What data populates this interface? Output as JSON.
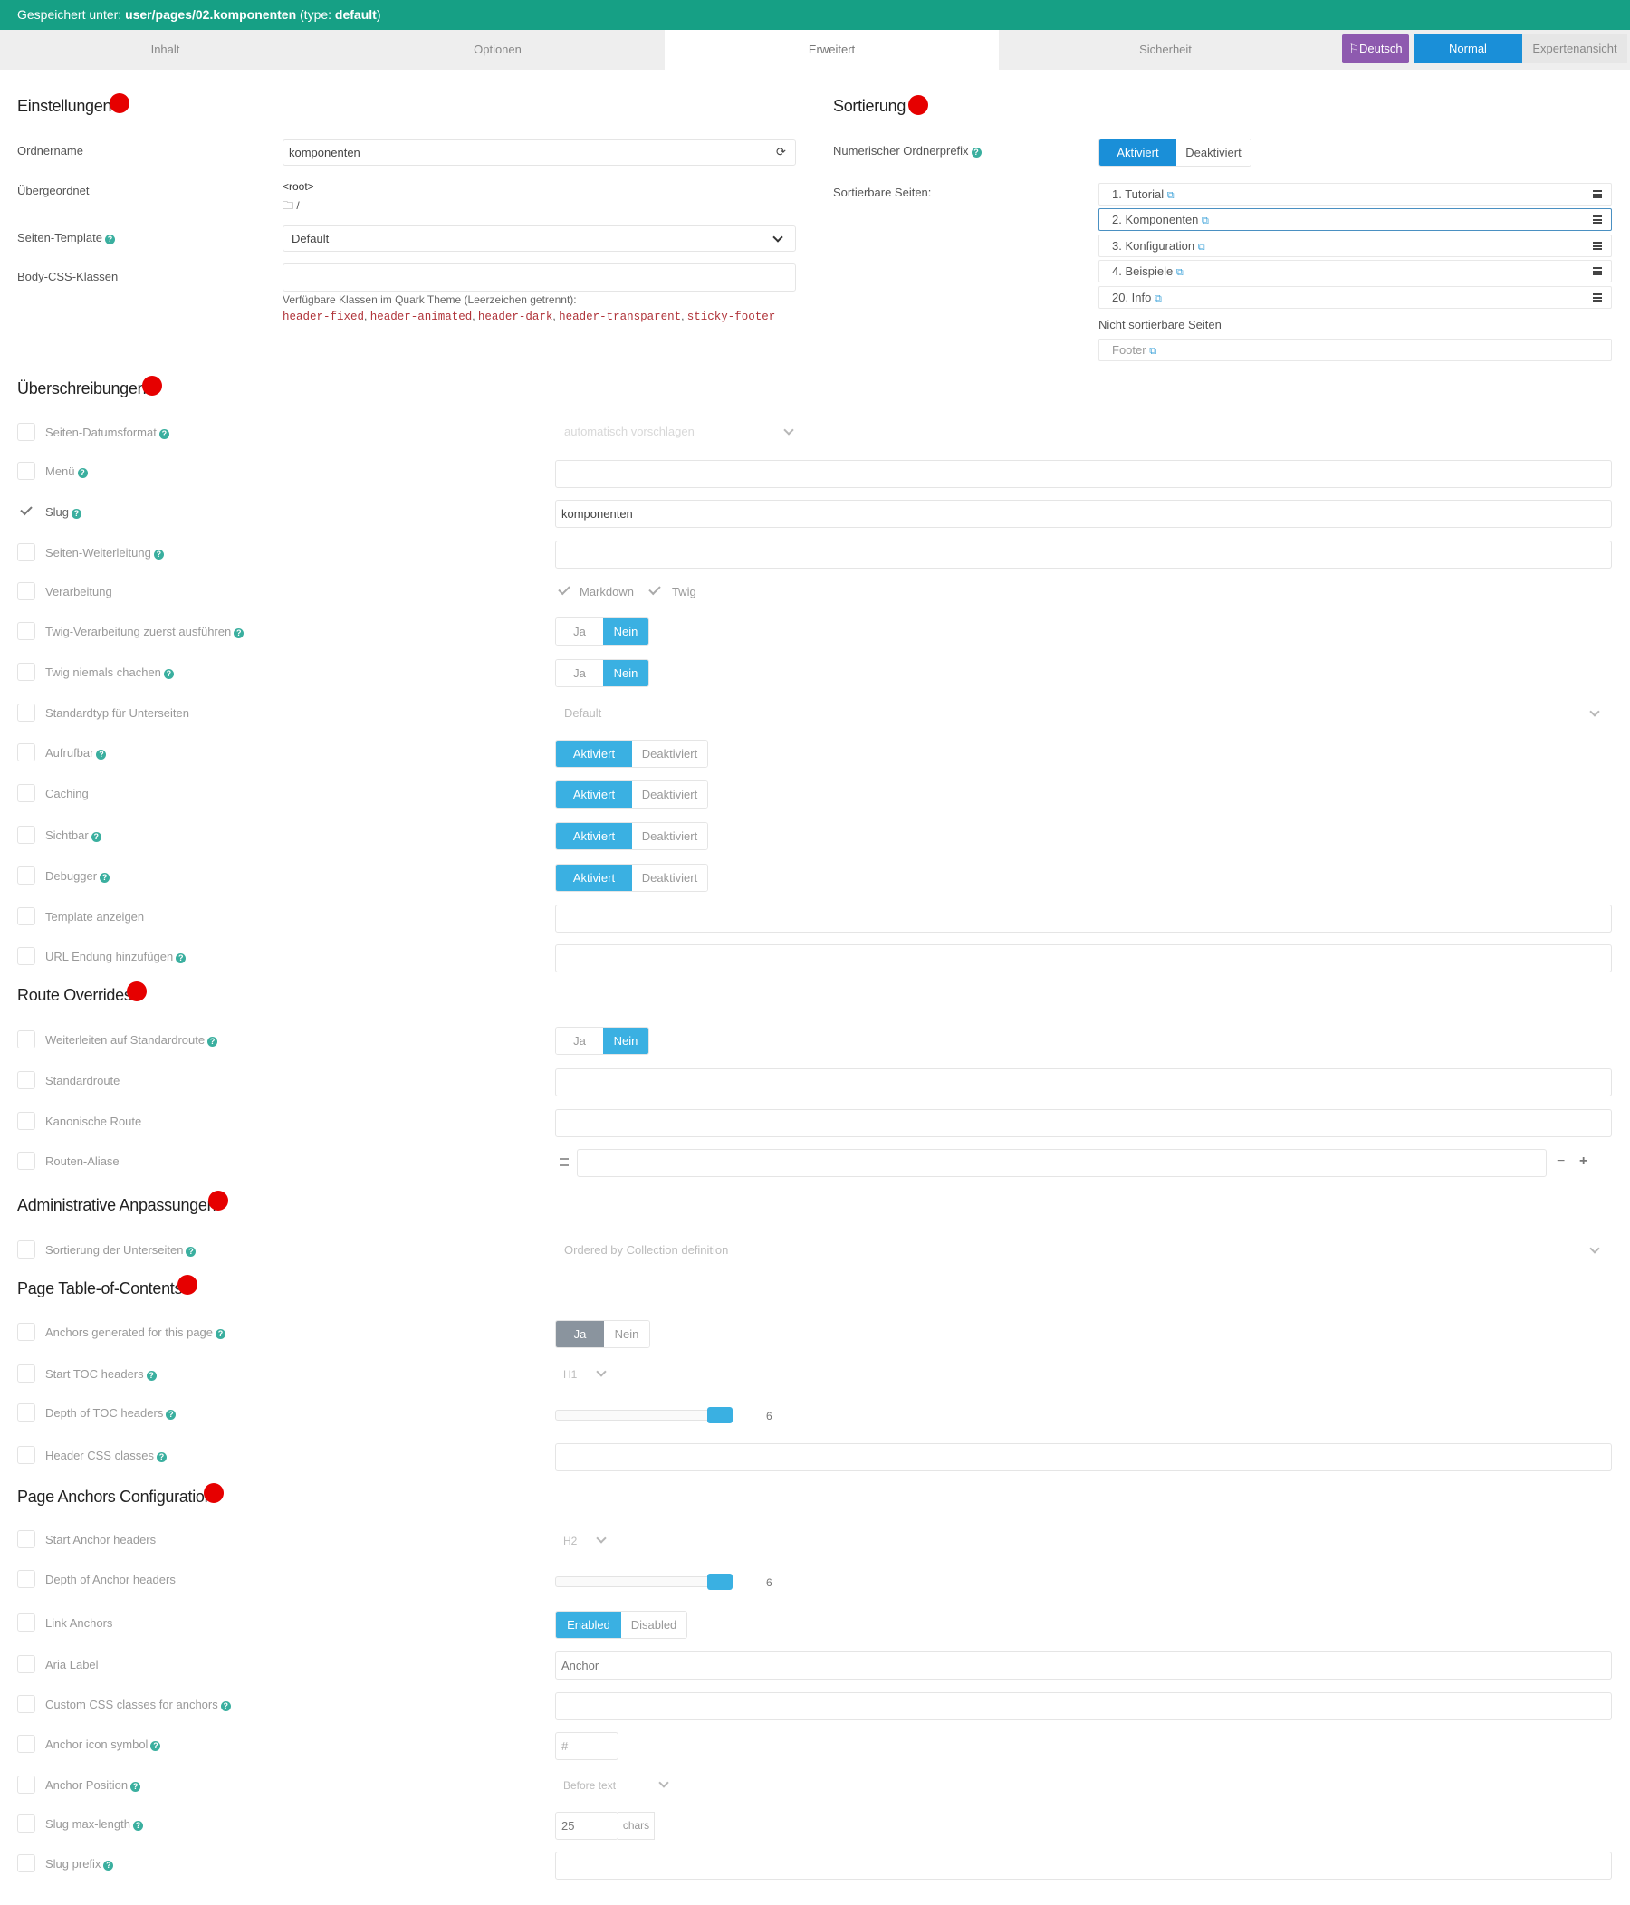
{
  "topbar": {
    "prefix": "Gespeichert unter: ",
    "path": "user/pages/02.komponenten",
    "type_prefix": " (type: ",
    "type": "default",
    "type_suffix": ")"
  },
  "tabs": [
    "Inhalt",
    "Optionen",
    "Erweitert",
    "Sicherheit"
  ],
  "active_tab": "Erweitert",
  "header_buttons": {
    "language": "Deutsch",
    "normal": "Normal",
    "expert": "Expertenansicht"
  },
  "colors": {
    "accent": "#16a085",
    "primary": "#3ab0e2",
    "badge": "#e60000",
    "language": "#8e5aaf"
  },
  "settings": {
    "title": "Einstellungen",
    "folder_label": "Ordnername",
    "folder_value": "komponenten",
    "parent_label": "Übergeordnet",
    "parent_value": "<root>",
    "parent_path": "/",
    "template_label": "Seiten-Template",
    "template_value": "Default",
    "body_css_label": "Body-CSS-Klassen",
    "body_css_value": "",
    "classes_hint": "Verfügbare Klassen im Quark Theme (Leerzeichen getrennt):",
    "classes": [
      "header-fixed",
      "header-animated",
      "header-dark",
      "header-transparent",
      "sticky-footer"
    ]
  },
  "sorting": {
    "title": "Sortierung",
    "numeric_prefix_label": "Numerischer Ordnerprefix",
    "numeric_on": "Aktiviert",
    "numeric_off": "Deaktiviert",
    "sortable_label": "Sortierbare Seiten:",
    "items": [
      "1. Tutorial",
      "2. Komponenten",
      "3. Konfiguration",
      "4. Beispiele",
      "20. Info"
    ],
    "unsortable_label": "Nicht sortierbare Seiten",
    "unsortable_items": [
      "Footer"
    ]
  },
  "overrides": {
    "title": "Überschreibungen",
    "date_format_label": "Seiten-Datumsformat",
    "date_format_value": "automatisch vorschlagen",
    "menu_label": "Menü",
    "slug_label": "Slug",
    "slug_value": "komponenten",
    "redirect_label": "Seiten-Weiterleitung",
    "process_label": "Verarbeitung",
    "process_markdown": "Markdown",
    "process_twig": "Twig",
    "twig_first_label": "Twig-Verarbeitung zuerst ausführen",
    "never_cache_twig_label": "Twig niemals chachen",
    "child_type_label": "Standardtyp für Unterseiten",
    "child_type_value": "Default",
    "routable_label": "Aufrufbar",
    "caching_label": "Caching",
    "visible_label": "Sichtbar",
    "debugger_label": "Debugger",
    "template_show_label": "Template anzeigen",
    "url_ext_label": "URL Endung hinzufügen",
    "yes": "Ja",
    "no": "Nein",
    "enabled": "Aktiviert",
    "disabled": "Deaktiviert"
  },
  "routes": {
    "title": "Route Overrides",
    "redirect_default_label": "Weiterleiten auf Standardroute",
    "default_route_label": "Standardroute",
    "canonical_label": "Kanonische Route",
    "aliases_label": "Routen-Aliase",
    "minus": "−",
    "plus": "+"
  },
  "admin": {
    "title": "Administrative Anpassungen",
    "child_order_label": "Sortierung der Unterseiten",
    "child_order_value": "Ordered by Collection definition"
  },
  "toc": {
    "title": "Page Table-of-Contents",
    "anchors_label": "Anchors generated for this page",
    "start_label": "Start TOC headers",
    "start_value": "H1",
    "depth_label": "Depth of TOC headers",
    "depth_value": "6",
    "depth_fraction": 1.0,
    "css_label": "Header CSS classes"
  },
  "anchors": {
    "title": "Page Anchors Configuration",
    "start_label": "Start Anchor headers",
    "start_value": "H2",
    "depth_label": "Depth of Anchor headers",
    "depth_value": "6",
    "depth_fraction": 1.0,
    "link_label": "Link Anchors",
    "link_on": "Enabled",
    "link_off": "Disabled",
    "aria_label": "Aria Label",
    "aria_value": "Anchor",
    "custom_css_label": "Custom CSS classes for anchors",
    "icon_label": "Anchor icon symbol",
    "icon_value": "#",
    "position_label": "Anchor Position",
    "position_value": "Before text",
    "slug_max_label": "Slug max-length",
    "slug_max_value": "25",
    "slug_max_unit": "chars",
    "slug_prefix_label": "Slug prefix"
  },
  "icons": {
    "help": "question-circle-icon",
    "external": "external-link-icon",
    "refresh": "refresh-icon",
    "folder": "folder-icon",
    "flag": "flag-icon",
    "drag": "drag-handle-icon",
    "chevron": "chevron-down-icon",
    "check": "checkmark-icon"
  }
}
